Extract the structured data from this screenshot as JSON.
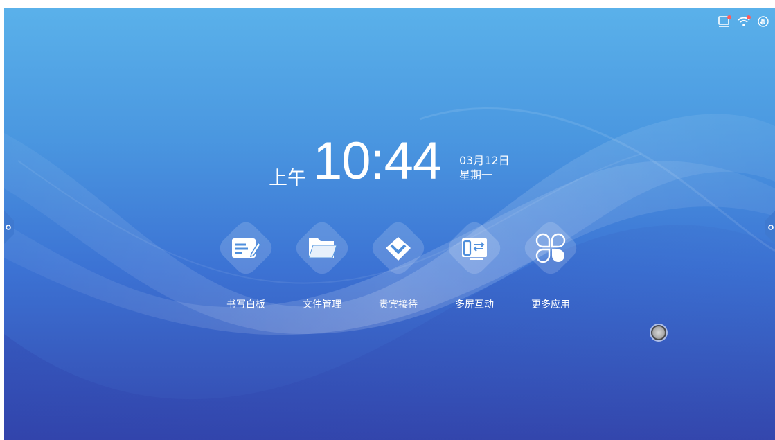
{
  "clock": {
    "ampm": "上午",
    "time": "10:44",
    "date": "03月12日",
    "weekday": "星期一"
  },
  "apps": [
    {
      "label": "书写白板",
      "icon": "whiteboard-pen-icon"
    },
    {
      "label": "文件管理",
      "icon": "folder-icon"
    },
    {
      "label": "贵宾接待",
      "icon": "diamond-gem-icon"
    },
    {
      "label": "多屏互动",
      "icon": "screen-mirroring-icon"
    },
    {
      "label": "更多应用",
      "icon": "apps-grid-icon"
    }
  ],
  "status_icons": [
    "cast-icon",
    "wifi-icon",
    "hand-touch-icon"
  ],
  "colors": {
    "bg_top": "#5ab1ea",
    "bg_bottom": "#3447ad",
    "text": "#ffffff"
  }
}
